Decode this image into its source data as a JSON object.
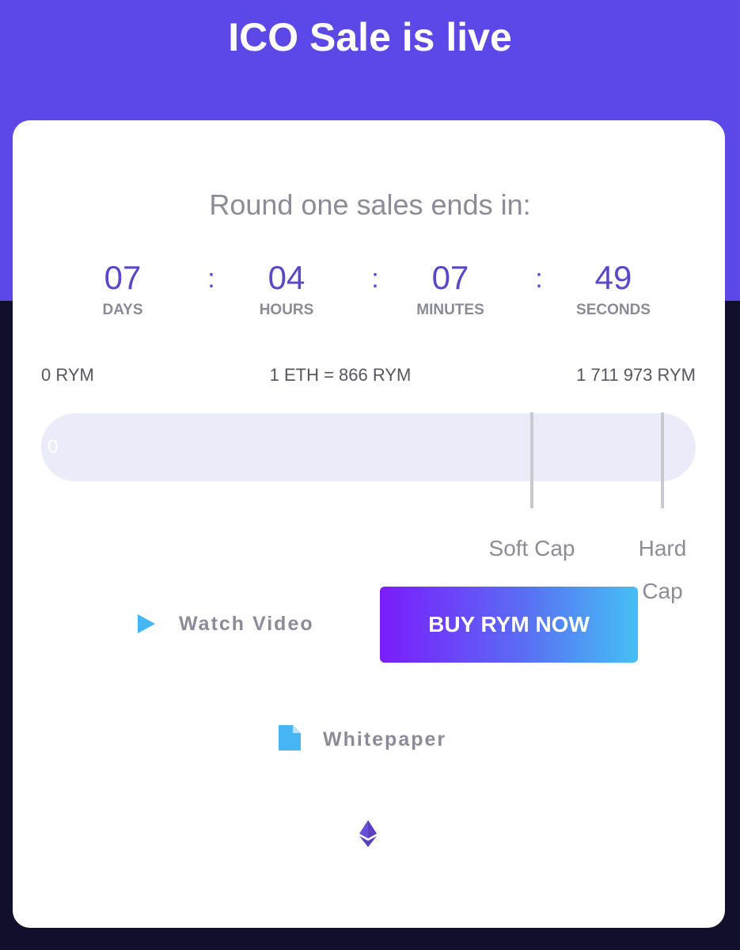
{
  "header": {
    "title": "ICO Sale is live"
  },
  "countdown": {
    "title": "Round one sales ends in:",
    "separator": ":",
    "units": [
      {
        "value": "07",
        "label": "DAYS"
      },
      {
        "value": "04",
        "label": "HOURS"
      },
      {
        "value": "07",
        "label": "MINUTES"
      },
      {
        "value": "49",
        "label": "SECONDS"
      }
    ]
  },
  "sale": {
    "min_label": "0 RYM",
    "rate_label": "1 ETH = 866 RYM",
    "max_label": "1 711 973 RYM",
    "raised_value": "0",
    "progress_fraction": 0,
    "soft_cap_label": "Soft Cap",
    "hard_cap_label": "Hard Cap"
  },
  "actions": {
    "watch_video_label": "Watch Video",
    "buy_label": "BUY RYM NOW",
    "whitepaper_label": "Whitepaper"
  },
  "colors": {
    "brand": "#5b48e6",
    "accent_blue": "#45b6f2",
    "accent_purple": "#7b1cfb"
  },
  "icons": {
    "play": "play-icon",
    "document": "document-icon",
    "ethereum": "ethereum-icon"
  }
}
